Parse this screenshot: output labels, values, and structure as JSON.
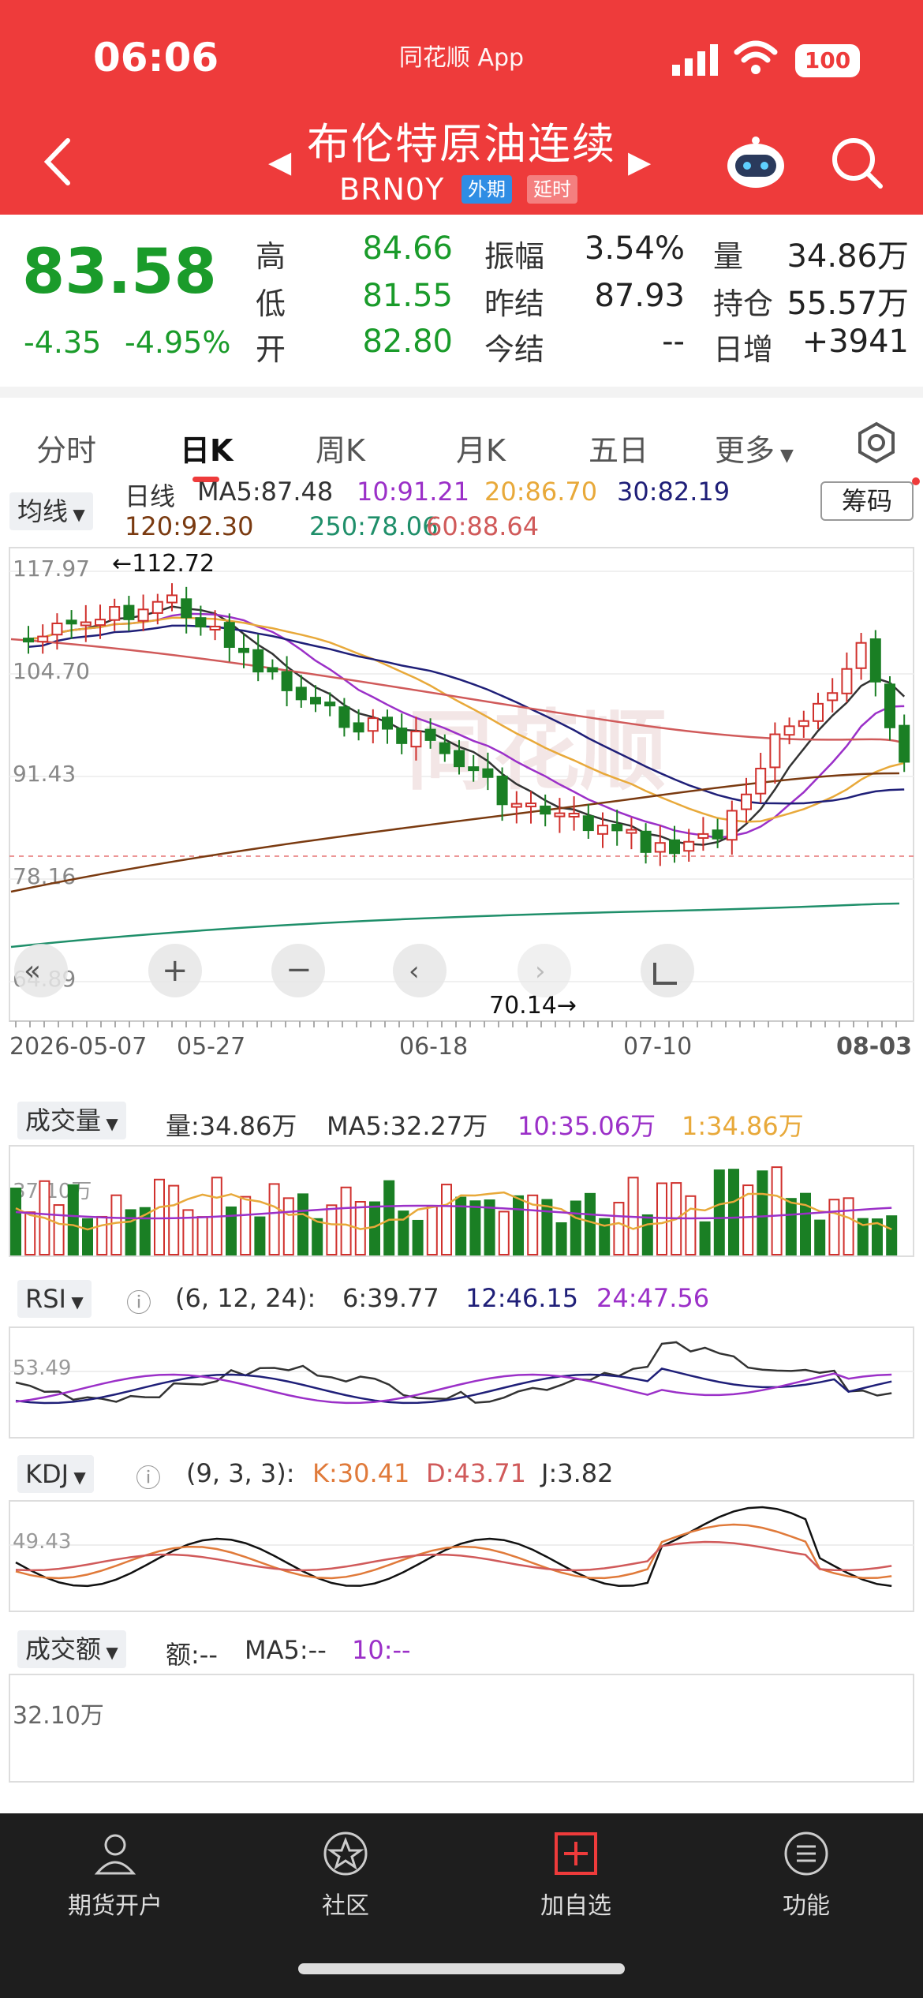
{
  "status_bar": {
    "time": "06:06",
    "app": "同花顺 App",
    "battery": "100"
  },
  "nav": {
    "title": "布伦特原油连续",
    "code": "BRN0Y",
    "tag_foreign": "外期",
    "tag_delay": "延时"
  },
  "quote": {
    "price": "83.58",
    "change": "-4.35",
    "change_pct": "-4.95%",
    "labels": {
      "high": "高",
      "low": "低",
      "open": "开",
      "amplitude": "振幅",
      "prev_settle": "昨结",
      "settle": "今结",
      "volume": "量",
      "open_interest": "持仓",
      "daily_inc": "日增"
    },
    "high": "84.66",
    "low": "81.55",
    "open": "82.80",
    "amplitude": "3.54%",
    "prev_settle": "87.93",
    "settle": "--",
    "volume": "34.86万",
    "open_interest": "55.57万",
    "daily_inc": "+3941"
  },
  "tabs": [
    "分时",
    "日K",
    "周K",
    "月K",
    "五日",
    "更多"
  ],
  "ma_bar": {
    "select": "均线",
    "label": "日线",
    "ma5": "MA5:87.48",
    "ma10": "10:91.21",
    "ma20": "20:86.70",
    "ma30": "30:82.19",
    "ma120": "120:92.30",
    "ma250": "250:78.06",
    "ma60": "60:88.64",
    "chips_button": "筹码"
  },
  "main_chart": {
    "y_ticks": [
      "117.97",
      "104.70",
      "91.43",
      "78.16",
      "64.89"
    ],
    "high_mark": "←112.72",
    "low_mark": "70.14→",
    "x_labels": [
      "2026-05-07",
      "05-27",
      "06-18",
      "07-10",
      "08-03"
    ]
  },
  "volume_bar": {
    "select": "成交量",
    "vol": "量:34.86万",
    "ma5": "MA5:32.27万",
    "ma10": "10:35.06万",
    "ma1": "1:34.86万",
    "y_tick": "37.10万"
  },
  "rsi_bar": {
    "select": "RSI",
    "params": "(6, 12, 24):",
    "r6": "6:39.77",
    "r12": "12:46.15",
    "r24": "24:47.56",
    "y_tick": "53.49"
  },
  "kdj_bar": {
    "select": "KDJ",
    "params": "(9, 3, 3):",
    "k": "K:30.41",
    "d": "D:43.71",
    "j": "J:3.82",
    "y_tick": "49.43"
  },
  "amount_bar": {
    "select": "成交额",
    "amt": "额:--",
    "ma5": "MA5:--",
    "ma10": "10:--",
    "y_tick": "32.10万"
  },
  "tabbar": [
    "期货开户",
    "社区",
    "加自选",
    "功能"
  ],
  "colors": {
    "brand_red": "#ee3b3b",
    "down_green": "#1a9b2a",
    "up_red": "#d0312d",
    "ma5": "#333333",
    "ma10": "#9b30c8",
    "ma20": "#e8a93a",
    "ma30": "#1f1f78",
    "ma60": "#d05a5a",
    "ma120": "#7a3a10",
    "ma250": "#1f8f6a"
  }
}
